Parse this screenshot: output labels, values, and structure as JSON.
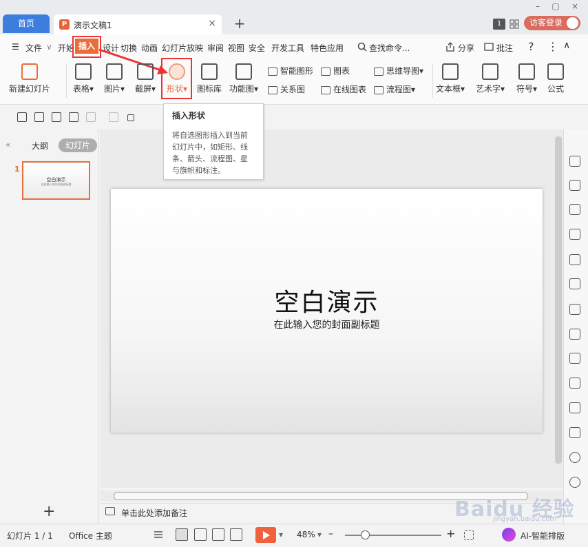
{
  "titlebar": {
    "home_tab": "首页",
    "doc_tab": "演示文稿1",
    "doc_icon": "P",
    "close_glyph": "×",
    "add_glyph": "+",
    "page_badge": "1",
    "login": "访客登录",
    "min_glyph": "–",
    "restore_glyph": "▢",
    "close_win_glyph": "×"
  },
  "menubar": {
    "hamburger": "☰",
    "file": "文件",
    "file_caret": "∨",
    "items": [
      "开始",
      "插入",
      "设计",
      "切换",
      "动画",
      "幻灯片放映",
      "审阅",
      "视图",
      "安全",
      "开发工具",
      "特色应用"
    ],
    "search": "查找命令...",
    "share": "分享",
    "annotate": "批注",
    "help": "?",
    "more": "⋮",
    "collapse": "∧"
  },
  "ribbon": {
    "new_slide": "新建幻灯片",
    "table": "表格",
    "picture": "图片",
    "screenshot": "截屏",
    "shape": "形状",
    "icon_lib": "图标库",
    "function_chart": "功能图",
    "smart_art": "智能图形",
    "chart": "图表",
    "relation": "关系图",
    "online_chart": "在线图表",
    "mindmap": "思维导图",
    "flowchart": "流程图",
    "textbox": "文本框",
    "wordart": "艺术字",
    "symbol": "符号",
    "formula": "公式",
    "caret": "▾"
  },
  "tooltip": {
    "title": "插入形状",
    "body": "将自选图形插入到当前幻灯片中，如矩形、线条、箭头、流程图、星与旗帜和标注。"
  },
  "leftpanel": {
    "collapse": "«",
    "outline": "大纲",
    "slides": "幻灯片",
    "thumb_number": "1",
    "thumb_title": "空白演示",
    "thumb_sub": "在此输入您的封面副标题",
    "add": "+"
  },
  "slide": {
    "title": "空白演示",
    "subtitle": "在此输入您的封面副标题"
  },
  "notes": {
    "placeholder": "单击此处添加备注"
  },
  "status": {
    "slide_count": "幻灯片 1 / 1",
    "theme": "Office 主题",
    "zoom": "48%",
    "zoom_caret": "▾",
    "minus": "–",
    "plus": "+",
    "ai": "AI-智能排版"
  },
  "watermark": {
    "text": "Baidu 经验",
    "url": "jingyan.baidu.com"
  },
  "colors": {
    "accent": "#e86d3c",
    "highlight_red": "#e33333",
    "home_tab_blue": "#3d7ddd",
    "play": "#f0623d"
  }
}
